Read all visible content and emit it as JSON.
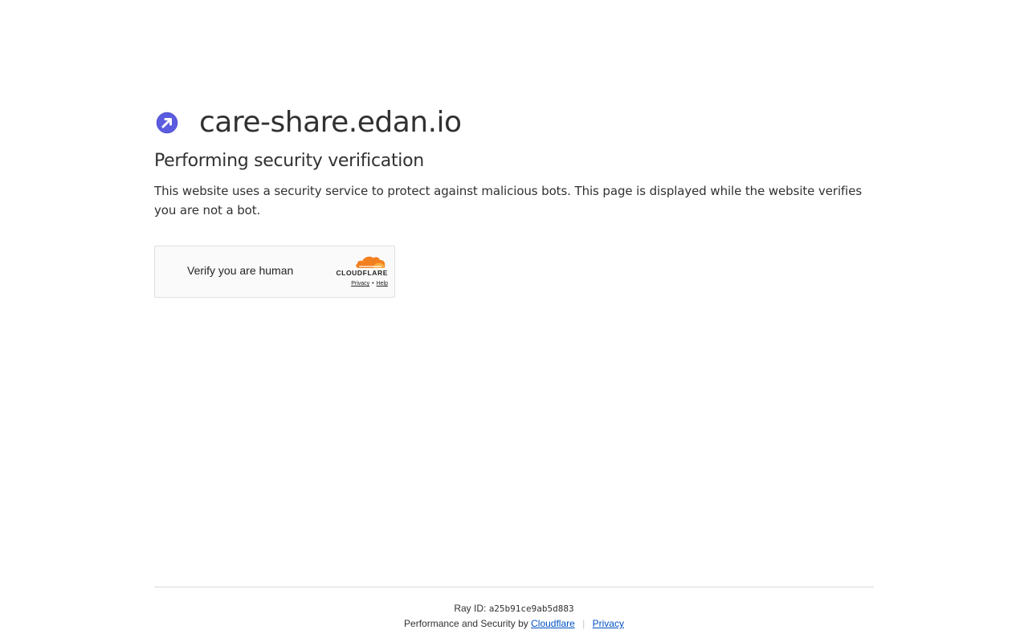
{
  "site": {
    "name": "care-share.edan.io",
    "logo_icon": "site-arrow-icon",
    "logo_color": "#5b5ce0"
  },
  "verification": {
    "heading": "Performing security verification",
    "description": "This website uses a security service to protect against malicious bots. This page is displayed while the website verifies you are not a bot."
  },
  "widget": {
    "label": "Verify you are human",
    "brand": "CLOUDFLARE",
    "privacy_link": "Privacy",
    "separator": "•",
    "help_link": "Help",
    "brand_color": "#f38020"
  },
  "footer": {
    "ray_label": "Ray ID:",
    "ray_id": "a25b91ce9ab5d883",
    "performance_text": "Performance and Security by",
    "cloudflare_link": "Cloudflare",
    "divider": "|",
    "privacy_link": "Privacy",
    "link_color": "#0051c3"
  }
}
